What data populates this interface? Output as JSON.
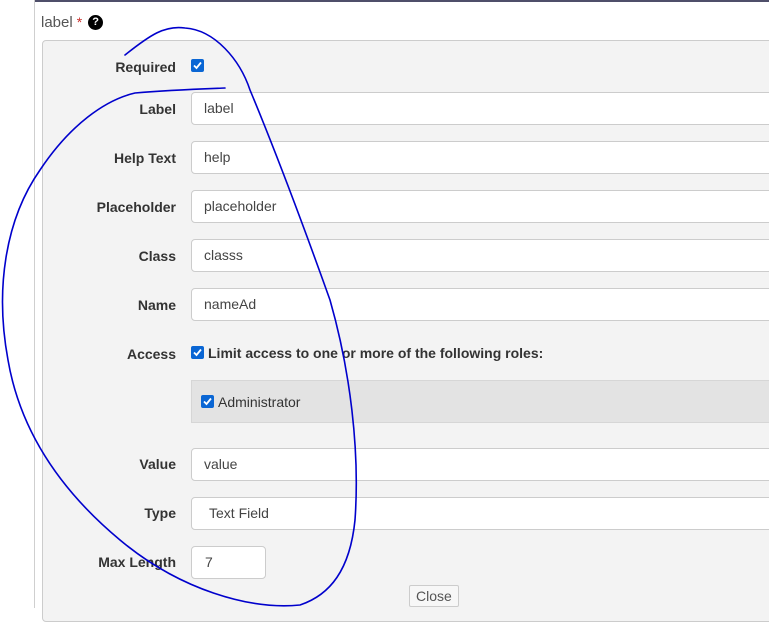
{
  "header": {
    "title": "label",
    "required_marker": "*",
    "help_icon": "?"
  },
  "form": {
    "required": {
      "label": "Required",
      "checked": true
    },
    "label_field": {
      "label": "Label",
      "value": "label"
    },
    "help_text": {
      "label": "Help Text",
      "value": "help"
    },
    "placeholder": {
      "label": "Placeholder",
      "value": "placeholder"
    },
    "class_field": {
      "label": "Class",
      "value": "classs"
    },
    "name_field": {
      "label": "Name",
      "value": "nameAd"
    },
    "access": {
      "label": "Access",
      "checked": true,
      "text": "Limit access to one or more of the following roles:",
      "roles": [
        {
          "name": "Administrator",
          "checked": true
        }
      ]
    },
    "value_field": {
      "label": "Value",
      "value": "value"
    },
    "type_field": {
      "label": "Type",
      "value": "Text Field"
    },
    "max_length": {
      "label": "Max Length",
      "value": "7"
    },
    "close_label": "Close"
  },
  "colors": {
    "checkbox": "#0a66d4",
    "annotation": "#0000cc",
    "required_star": "#c9302c"
  }
}
